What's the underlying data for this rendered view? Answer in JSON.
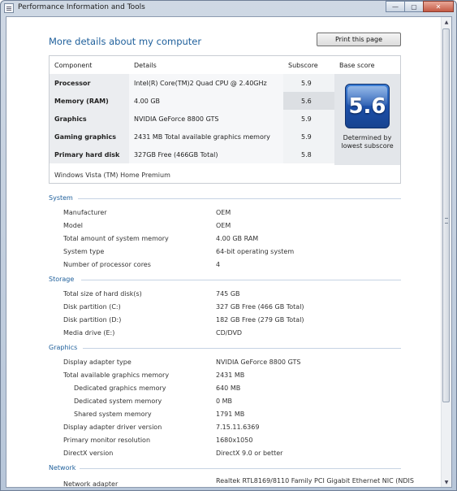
{
  "window": {
    "title": "Performance Information and Tools",
    "min_label": "—",
    "max_label": "▢",
    "close_label": "✕"
  },
  "heading": "More details about my computer",
  "print_button": "Print this page",
  "score_table": {
    "headers": [
      "Component",
      "Details",
      "Subscore",
      "Base score"
    ],
    "rows": [
      {
        "component": "Processor",
        "details": "Intel(R) Core(TM)2 Quad CPU @ 2.40GHz",
        "subscore": "5.9"
      },
      {
        "component": "Memory (RAM)",
        "details": "4.00 GB",
        "subscore": "5.6"
      },
      {
        "component": "Graphics",
        "details": "NVIDIA GeForce 8800 GTS",
        "subscore": "5.9"
      },
      {
        "component": "Gaming graphics",
        "details": "2431 MB Total available graphics memory",
        "subscore": "5.9"
      },
      {
        "component": "Primary hard disk",
        "details": "327GB Free (466GB Total)",
        "subscore": "5.8"
      }
    ],
    "base_score": "5.6",
    "base_caption_1": "Determined by",
    "base_caption_2": "lowest subscore",
    "os": "Windows Vista (TM) Home Premium"
  },
  "sections": {
    "system": {
      "title": "System",
      "items": [
        {
          "label": "Manufacturer",
          "value": "OEM"
        },
        {
          "label": "Model",
          "value": "OEM"
        },
        {
          "label": "Total amount of system memory",
          "value": "4.00 GB RAM"
        },
        {
          "label": "System type",
          "value": "64-bit operating system"
        },
        {
          "label": "Number of processor cores",
          "value": "4"
        }
      ]
    },
    "storage": {
      "title": "Storage",
      "items": [
        {
          "label": "Total size of hard disk(s)",
          "value": "745 GB"
        },
        {
          "label": "Disk partition (C:)",
          "value": "327 GB Free (466 GB Total)"
        },
        {
          "label": "Disk partition (D:)",
          "value": "182 GB Free (279 GB Total)"
        },
        {
          "label": "Media drive (E:)",
          "value": "CD/DVD"
        }
      ]
    },
    "graphics": {
      "title": "Graphics",
      "items": [
        {
          "label": "Display adapter type",
          "value": "NVIDIA GeForce 8800 GTS"
        },
        {
          "label": "Total available graphics memory",
          "value": "2431 MB"
        },
        {
          "label": "Dedicated graphics memory",
          "value": "640 MB"
        },
        {
          "label": "Dedicated system memory",
          "value": "0 MB"
        },
        {
          "label": "Shared system memory",
          "value": "1791 MB"
        },
        {
          "label": "Display adapter driver version",
          "value": "7.15.11.6369"
        },
        {
          "label": "Primary monitor resolution",
          "value": "1680x1050"
        },
        {
          "label": "DirectX version",
          "value": "DirectX 9.0 or better"
        }
      ]
    },
    "network": {
      "title": "Network",
      "items": [
        {
          "label": "Network adapter",
          "value": "Realtek RTL8169/8110 Family PCI Gigabit Ethernet NIC (NDIS"
        }
      ]
    }
  }
}
